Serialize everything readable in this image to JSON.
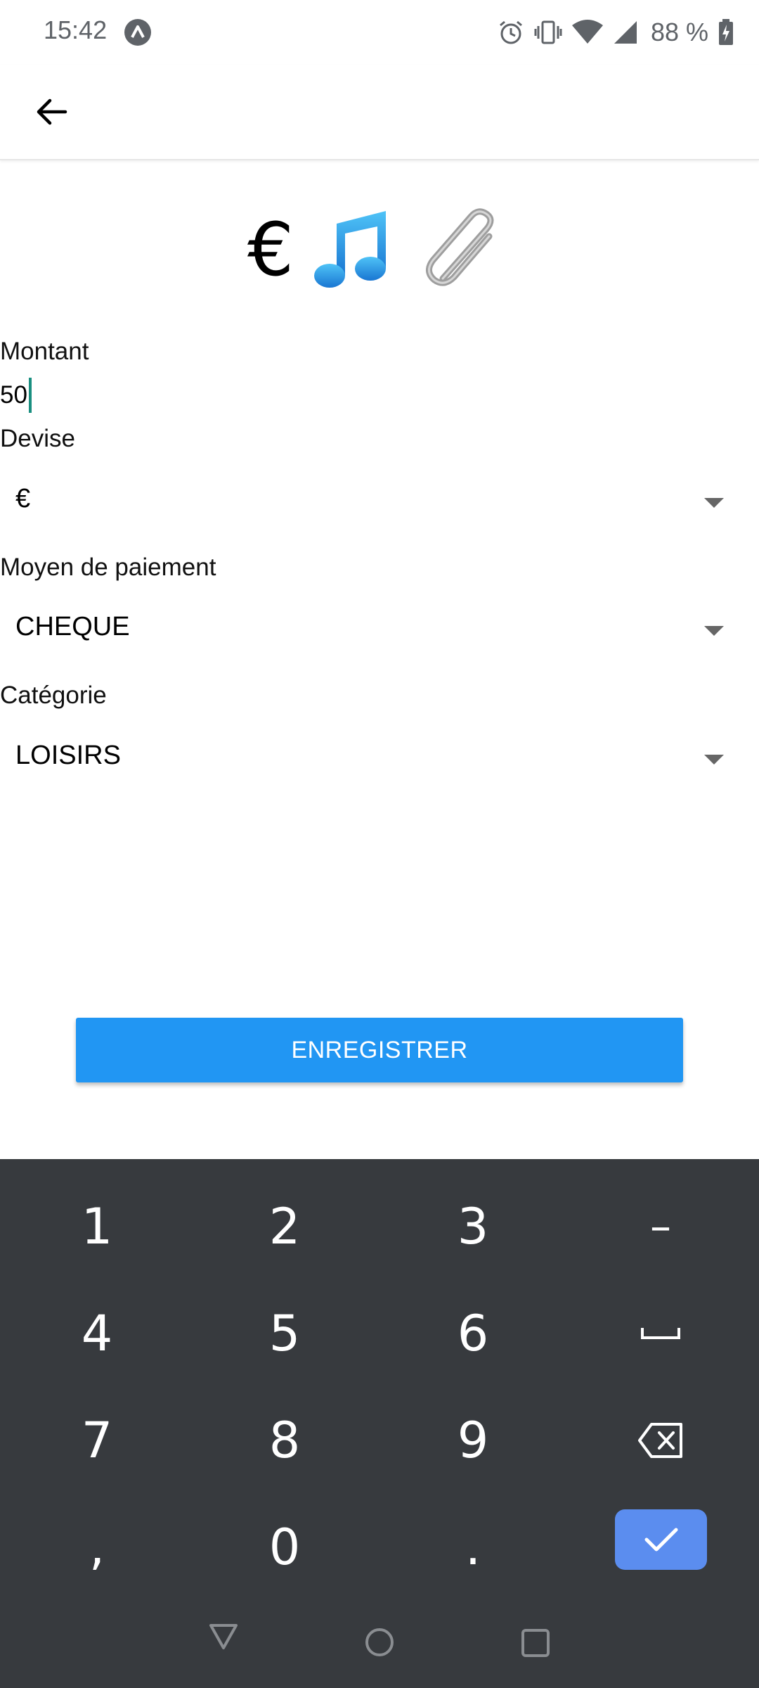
{
  "status_bar": {
    "time": "15:42",
    "battery_text": "88 %",
    "icons": [
      "app-notification-icon",
      "alarm-icon",
      "vibrate-icon",
      "wifi-icon",
      "signal-icon",
      "battery-charging-icon"
    ]
  },
  "app_bar": {
    "back_icon": "arrow-left-icon"
  },
  "header_icons": {
    "currency_symbol": "€",
    "icons": [
      "euro-icon",
      "music-note-icon",
      "paperclip-icon"
    ]
  },
  "form": {
    "amount_label": "Montant",
    "amount_value": "50",
    "currency_label": "Devise",
    "currency_value": "€",
    "payment_label": "Moyen de paiement",
    "payment_value": "CHEQUE",
    "category_label": "Catégorie",
    "category_value": "LOISIRS"
  },
  "save_button": {
    "label": "ENREGISTRER",
    "color": "#2196f3"
  },
  "keyboard": {
    "keys": [
      "1",
      "2",
      "3",
      "–",
      "4",
      "5",
      "6",
      "␣",
      "7",
      "8",
      "9",
      "⌫",
      ",",
      "0",
      ".",
      "✓"
    ],
    "enter_color": "#5b8def",
    "background": "#373a3e"
  },
  "nav_bar": {
    "icons": [
      "nav-back-icon",
      "nav-home-icon",
      "nav-recents-icon"
    ]
  }
}
